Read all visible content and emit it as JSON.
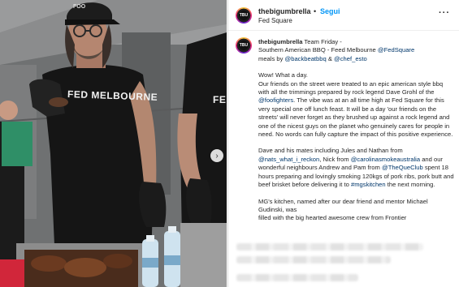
{
  "post": {
    "username": "thebigumbrella",
    "separator": "•",
    "follow_label": "Segui",
    "location": "Fed Square",
    "more_label": "···",
    "avatar_text": "TBU",
    "photo": {
      "shirt_text_a": "FED MELBOURNE",
      "shirt_text_b": "FED",
      "next_icon": "›"
    }
  },
  "caption": {
    "username": "thebigumbrella",
    "line1_a": "Team Friday -",
    "line1_b": "Southern American BBQ - Feed Melbourne",
    "mention_fedsquare": "@FedSquare",
    "line1_c": "meals by",
    "mention_backbeat": "@backbeatbbq",
    "amp": "&",
    "mention_chef": "@chef_esto",
    "p1_a": "Wow! What a day.",
    "p1_b": "Our friends on the street were treated to an epic american style bbq with all the trimmings prepared by rock legend Dave Grohl of the",
    "mention_foofighters": "@foofighters",
    "p1_c": ". The vibe was at an all time high at Fed Square for this very special one off lunch feast. It will be a day 'our friends on the streets' will never forget as they brushed up against a rock legend and one of the nicest guys on the planet who genuinely cares for people in need. No words can fully capture the impact of this positive experience.",
    "p2_a": "Dave and his mates including Jules and Nathan from",
    "mention_nats": "@nats_what_i_reckon",
    "p2_b": ", Nick from",
    "mention_carolina": "@carolinasmokeaustralia",
    "p2_c": "and our wonderful neighbours Andrew and Pam from",
    "mention_queclub": "@TheQueClub",
    "p2_d": "spent 18 hours preparing and lovingly smoking 120kgs of pork ribs, pork butt and beef brisket before delivering it to",
    "mention_mgskitchen": "#mgskitchen",
    "p2_e": "the next morning.",
    "p3_a": "MG's kitchen, named after our dear friend and mentor Michael Gudinski, was",
    "p3_b": "filled with the big hearted awesome crew from Frontier"
  }
}
